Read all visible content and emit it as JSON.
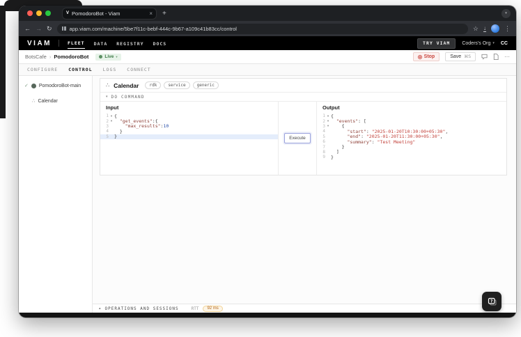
{
  "colors": {
    "live_green": "#3d7a47",
    "stop_red": "#c9463e",
    "rtt_orange": "#b2661c",
    "execute_accent": "#98a0dc"
  },
  "browser": {
    "tab_title": "PomodoroBot - Viam",
    "url": "app.viam.com/machine/5be7f11c-bebf-444c-9b67-a109c41b83cc/control"
  },
  "nav": {
    "brand": "VIAM",
    "items": [
      {
        "label": "FLEET"
      },
      {
        "label": "DATA"
      },
      {
        "label": "REGISTRY"
      },
      {
        "label": "DOCS"
      }
    ],
    "try_viam": "TRY VIAM",
    "org": "Coders's Org",
    "avatar": "CC"
  },
  "machine_bar": {
    "crumb_parent": "BotsCafe",
    "crumb_current": "PomodoroBot",
    "live_label": "Live",
    "stop_label": "Stop",
    "save_label": "Save",
    "save_shortcut": "⌘S"
  },
  "tabs": [
    {
      "label": "CONFIGURE"
    },
    {
      "label": "CONTROL"
    },
    {
      "label": "LOGS"
    },
    {
      "label": "CONNECT"
    }
  ],
  "sidebar": {
    "machine": "PomodoroBot-main",
    "component": "Calendar"
  },
  "card": {
    "title": "Calendar",
    "badges": [
      "rdk",
      "service",
      "generic"
    ],
    "section": "DO COMMAND",
    "execute_label": "Execute",
    "input": {
      "label": "Input",
      "lines": [
        {
          "n": 1,
          "fold": true,
          "tokens": [
            {
              "t": "p",
              "v": "{"
            }
          ]
        },
        {
          "n": 2,
          "fold": true,
          "tokens": [
            {
              "t": "p",
              "v": "  "
            },
            {
              "t": "k",
              "v": "\"get_events\""
            },
            {
              "t": "p",
              "v": ":{"
            }
          ]
        },
        {
          "n": 3,
          "tokens": [
            {
              "t": "p",
              "v": "    "
            },
            {
              "t": "k",
              "v": "\"max_results\""
            },
            {
              "t": "p",
              "v": ":"
            },
            {
              "t": "n",
              "v": "10"
            }
          ]
        },
        {
          "n": 4,
          "tokens": [
            {
              "t": "p",
              "v": "  }"
            }
          ]
        },
        {
          "n": 5,
          "active": true,
          "tokens": [
            {
              "t": "p",
              "v": "}"
            }
          ]
        }
      ]
    },
    "output": {
      "label": "Output",
      "lines": [
        {
          "n": 1,
          "fold": true,
          "tokens": [
            {
              "t": "p",
              "v": "{"
            }
          ]
        },
        {
          "n": 2,
          "fold": true,
          "tokens": [
            {
              "t": "p",
              "v": "  "
            },
            {
              "t": "k",
              "v": "\"events\""
            },
            {
              "t": "p",
              "v": ": ["
            }
          ]
        },
        {
          "n": 3,
          "fold": true,
          "tokens": [
            {
              "t": "p",
              "v": "    "
            },
            {
              "t": "p",
              "v": "{"
            }
          ]
        },
        {
          "n": 4,
          "tokens": [
            {
              "t": "p",
              "v": "      "
            },
            {
              "t": "k",
              "v": "\"start\""
            },
            {
              "t": "p",
              "v": ": "
            },
            {
              "t": "s",
              "v": "\"2025-01-20T10:30:00+05:30\""
            },
            {
              "t": "p",
              "v": ","
            }
          ]
        },
        {
          "n": 5,
          "tokens": [
            {
              "t": "p",
              "v": "      "
            },
            {
              "t": "k",
              "v": "\"end\""
            },
            {
              "t": "p",
              "v": ": "
            },
            {
              "t": "s",
              "v": "\"2025-01-20T11:30:00+05:30\""
            },
            {
              "t": "p",
              "v": ","
            }
          ]
        },
        {
          "n": 6,
          "tokens": [
            {
              "t": "p",
              "v": "      "
            },
            {
              "t": "k",
              "v": "\"summary\""
            },
            {
              "t": "p",
              "v": ": "
            },
            {
              "t": "s",
              "v": "\"Test Meeting\""
            }
          ]
        },
        {
          "n": 7,
          "tokens": [
            {
              "t": "p",
              "v": "    }"
            }
          ]
        },
        {
          "n": 8,
          "tokens": [
            {
              "t": "p",
              "v": "  ]"
            }
          ]
        },
        {
          "n": 9,
          "tokens": [
            {
              "t": "p",
              "v": "}"
            }
          ]
        }
      ]
    }
  },
  "footer": {
    "ops_label": "OPERATIONS AND SESSIONS",
    "rtt_label": "RTT",
    "rtt_value": "92 ms"
  }
}
